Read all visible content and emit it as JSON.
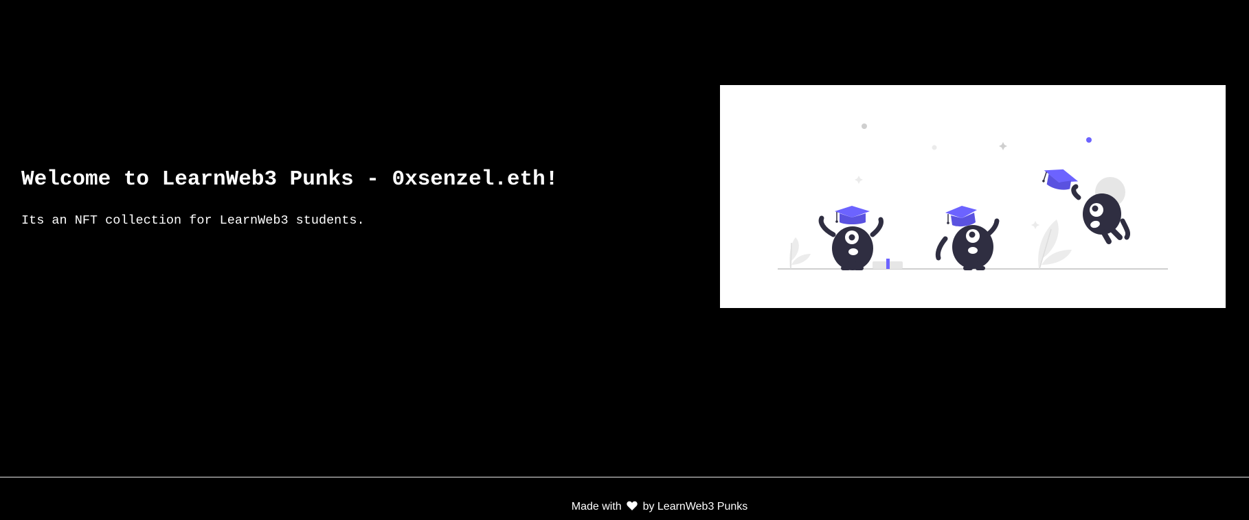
{
  "main": {
    "title": "Welcome to LearnWeb3 Punks - 0xsenzel.eth!",
    "description": "Its an NFT collection for LearnWeb3 students."
  },
  "illustration": {
    "icon": "graduation-illustration",
    "accent_color": "#6c63ff",
    "figure_color": "#2f2e41"
  },
  "footer": {
    "prefix": "Made with",
    "icon": "heart-icon",
    "suffix": "by LearnWeb3 Punks"
  }
}
